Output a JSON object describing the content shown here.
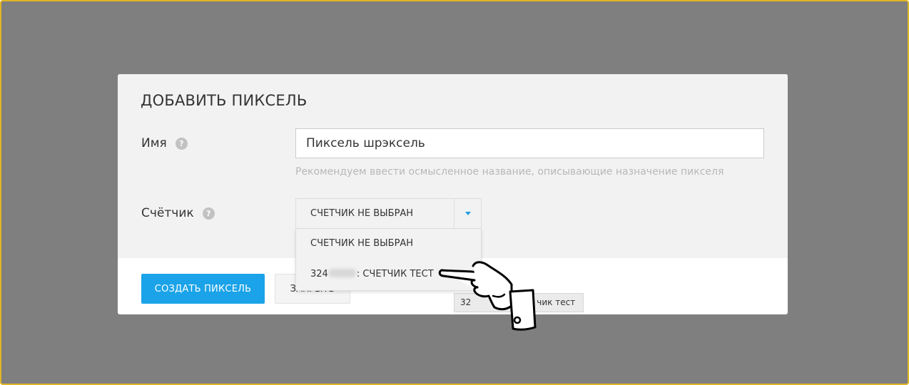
{
  "modal": {
    "title": "ДОБАВИТЬ ПИКСЕЛЬ",
    "name_field": {
      "label": "Имя",
      "value": "Пиксель шрэксель",
      "hint": "Рекомендуем ввести осмысленное название, описывающие назначение пикселя",
      "help_icon": "help-icon"
    },
    "counter_field": {
      "label": "Счётчик",
      "selected": "СЧЕТЧИК НЕ ВЫБРАН",
      "help_icon": "help-icon",
      "options": [
        {
          "label": "СЧЕТЧИК НЕ ВЫБРАН"
        },
        {
          "id_prefix": "324",
          "label_suffix": ": СЧЕТЧИК ТЕСТ"
        }
      ]
    },
    "buttons": {
      "create": "СОЗДАТЬ ПИКСЕЛЬ",
      "close": "ЗАКРЫТЬ"
    },
    "tooltip": {
      "prefix": "32",
      "suffix": "чик тест"
    }
  },
  "colors": {
    "overlay": "#7f7f7f",
    "frame_border": "#e0b527",
    "primary_button": "#1aa3e8",
    "caret": "#1e9ce0"
  },
  "cursor": "hand-pointer-icon"
}
